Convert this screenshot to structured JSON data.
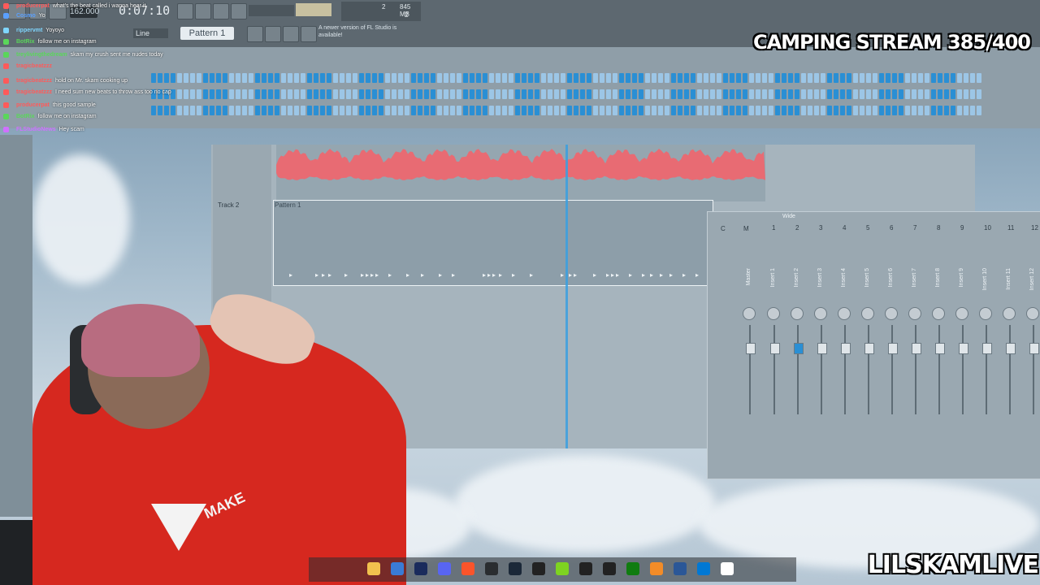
{
  "app": {
    "time": "0:07:10",
    "bpm": "162.000",
    "snap": "Line",
    "pattern": "Pattern 1",
    "news": "A newer version of FL Studio is available!",
    "memory": "845 MB",
    "voices": "2",
    "cpu": "2"
  },
  "overlays": {
    "stream_title": "CAMPING STREAM 385/400",
    "channel_name": "LILSKAMLIVE"
  },
  "chat": [
    {
      "name": "producerpat",
      "message": "what's the beat called i wanna hear it",
      "name_color": "#ff5a5a"
    },
    {
      "name": "Cosmo",
      "message": "Yo",
      "name_color": "#5aa0ff"
    },
    {
      "name": "rippervmt",
      "message": "Yoyoyo",
      "name_color": "#7fd6ff"
    },
    {
      "name": "BotRix",
      "message": "follow me on instagram",
      "name_color": "#5ad65a"
    },
    {
      "name": "treylivingthedream",
      "message": "skam my crush sent me nudes today",
      "name_color": "#5ad65a"
    },
    {
      "name": "tragicbeatzzz",
      "message": "",
      "name_color": "#ff5a5a"
    },
    {
      "name": "tragicbeatzzz",
      "message": "hold on Mr. skam cooking up",
      "name_color": "#ff5a5a"
    },
    {
      "name": "tragicbeatzzz",
      "message": "I need sum new beats to throw ass too no cap",
      "name_color": "#ff5a5a"
    },
    {
      "name": "producerpat",
      "message": "this good sample",
      "name_color": "#ff5a5a"
    },
    {
      "name": "BotRix",
      "message": "follow me on instagram",
      "name_color": "#5ad65a"
    },
    {
      "name": "FLStudioNews",
      "message": "Hey scam",
      "name_color": "#d070ff"
    }
  ],
  "playlist": {
    "track2_label": "Track 2",
    "pattern_clip_label": "Pattern 1"
  },
  "mixer": {
    "title": "Wide",
    "channel_letters": [
      "C",
      "M"
    ],
    "channel_numbers": [
      "1",
      "2",
      "3",
      "4",
      "5",
      "6",
      "7",
      "8",
      "9",
      "10",
      "11",
      "12"
    ],
    "channel_names": [
      "Master",
      "Insert 1",
      "Insert 2",
      "Insert 3",
      "Insert 4",
      "Insert 5",
      "Insert 6",
      "Insert 7",
      "Insert 8",
      "Insert 9",
      "Insert 10",
      "Insert 11",
      "Insert 12"
    ]
  },
  "hoodie": {
    "text": "MAKE"
  },
  "taskbar_icons": [
    "explorer-icon",
    "store-icon",
    "photoshop-icon",
    "discord-icon",
    "brave-icon",
    "obs-icon",
    "steam-icon",
    "capcut-icon",
    "bluestacks-icon",
    "4k-icon",
    "capcut2-icon",
    "xbox-icon",
    "fl-icon",
    "calculator-icon",
    "photos-icon",
    "file-icon"
  ]
}
